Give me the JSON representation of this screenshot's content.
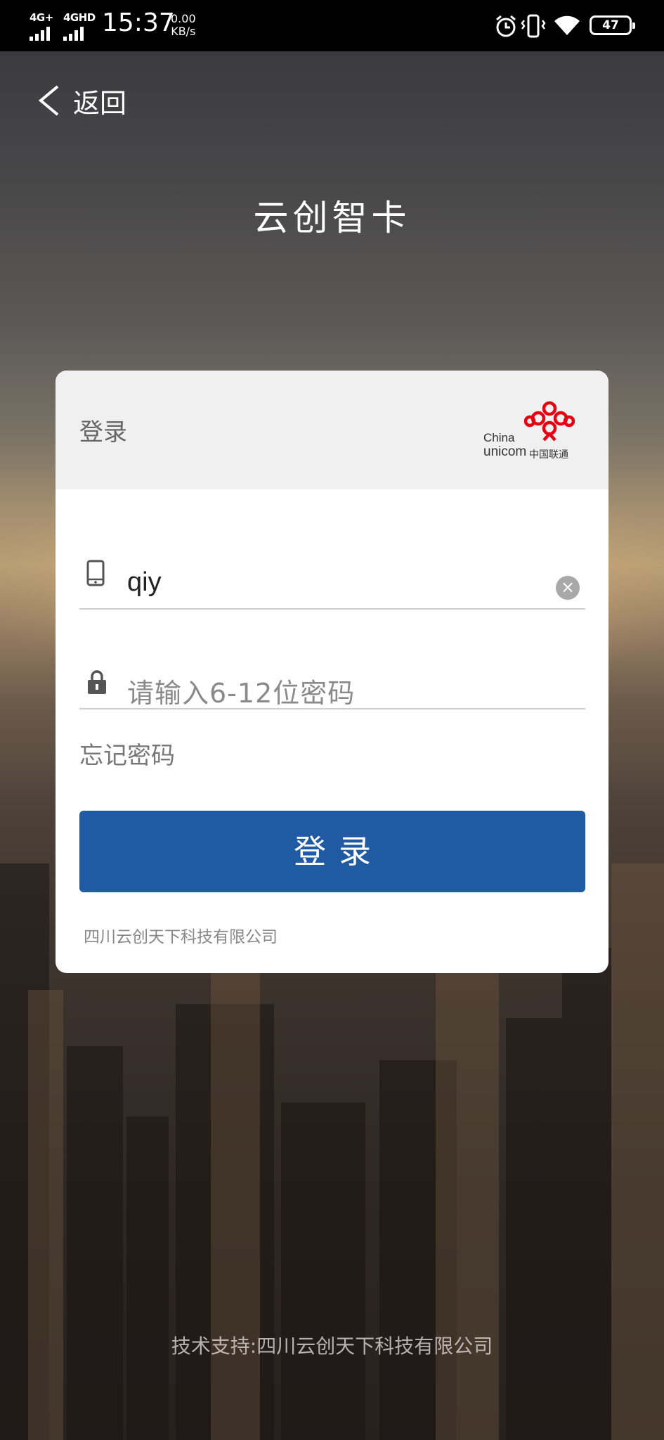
{
  "status_bar": {
    "network1": "4G+",
    "network2": "4GHD",
    "time": "15:37",
    "speed_value": "0.00",
    "speed_unit": "KB/s",
    "battery": "47",
    "icons": [
      "alarm-icon",
      "vibrate-icon",
      "wifi-icon",
      "battery-icon"
    ]
  },
  "header": {
    "back_label": "返回",
    "title": "云创智卡"
  },
  "card": {
    "heading": "登录",
    "logo": {
      "en_line1": "China",
      "en_line2": "unicom",
      "cn": "中国联通",
      "color": "#e60012"
    },
    "phone": {
      "value": "qiy",
      "icon": "phone-icon"
    },
    "password": {
      "placeholder": "请输入6-12位密码",
      "icon": "lock-icon"
    },
    "forgot": "忘记密码",
    "login_button": "登录",
    "company": "四川云创天下科技有限公司"
  },
  "footer": {
    "support": "技术支持:四川云创天下科技有限公司"
  },
  "colors": {
    "primary_button": "#1f5aa3",
    "card_header": "#f0f0f0"
  }
}
